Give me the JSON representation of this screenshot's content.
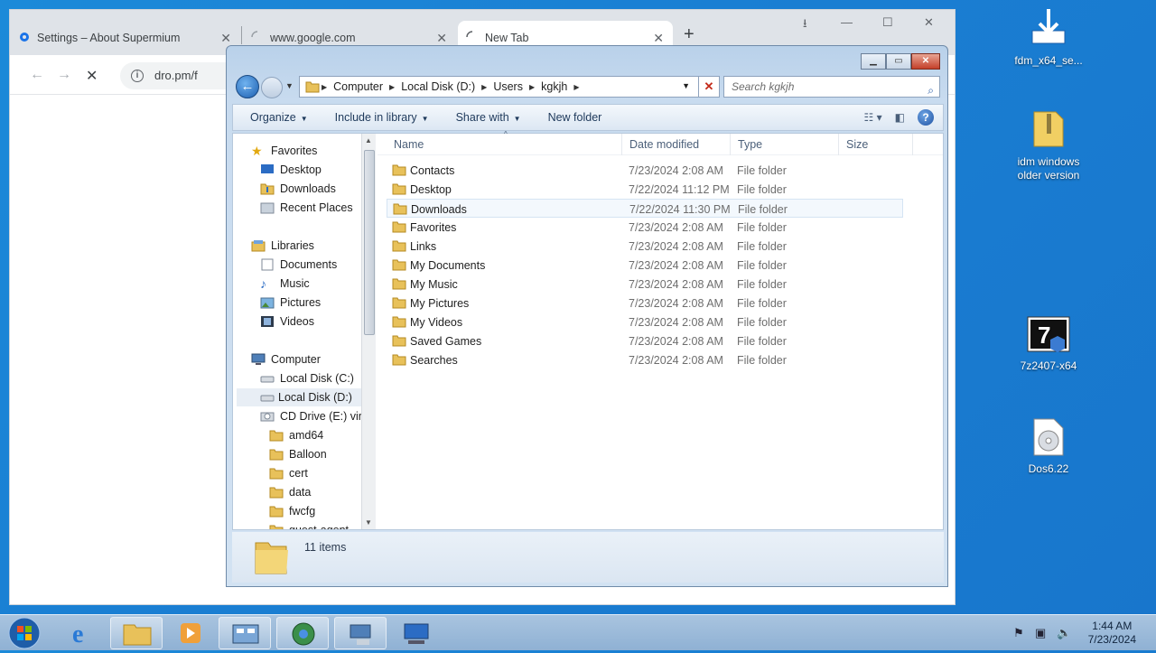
{
  "browser": {
    "tabs": [
      {
        "label": "Settings – About Supermium",
        "icon": "gear-icon"
      },
      {
        "label": "www.google.com",
        "icon": "loading-icon"
      },
      {
        "label": "New Tab",
        "icon": "loading-icon"
      }
    ],
    "address": "dro.pm/f"
  },
  "explorer": {
    "breadcrumb": [
      "Computer",
      "Local Disk (D:)",
      "Users",
      "kgkjh"
    ],
    "search_placeholder": "Search kgkjh",
    "toolbar": {
      "organize": "Organize",
      "include": "Include in library",
      "share": "Share with",
      "newfolder": "New folder"
    },
    "nav": {
      "favorites": "Favorites",
      "fav_items": [
        "Desktop",
        "Downloads",
        "Recent Places"
      ],
      "libraries": "Libraries",
      "lib_items": [
        "Documents",
        "Music",
        "Pictures",
        "Videos"
      ],
      "computer": "Computer",
      "drives": [
        "Local Disk (C:)",
        "Local Disk (D:)",
        "CD Drive (E:) virti"
      ],
      "cd_folders": [
        "amd64",
        "Balloon",
        "cert",
        "data",
        "fwcfg",
        "guest-agent"
      ]
    },
    "columns": {
      "name": "Name",
      "date": "Date modified",
      "type": "Type",
      "size": "Size"
    },
    "files": [
      {
        "name": "Contacts",
        "date": "7/23/2024 2:08 AM",
        "type": "File folder"
      },
      {
        "name": "Desktop",
        "date": "7/22/2024 11:12 PM",
        "type": "File folder"
      },
      {
        "name": "Downloads",
        "date": "7/22/2024 11:30 PM",
        "type": "File folder"
      },
      {
        "name": "Favorites",
        "date": "7/23/2024 2:08 AM",
        "type": "File folder"
      },
      {
        "name": "Links",
        "date": "7/23/2024 2:08 AM",
        "type": "File folder"
      },
      {
        "name": "My Documents",
        "date": "7/23/2024 2:08 AM",
        "type": "File folder"
      },
      {
        "name": "My Music",
        "date": "7/23/2024 2:08 AM",
        "type": "File folder"
      },
      {
        "name": "My Pictures",
        "date": "7/23/2024 2:08 AM",
        "type": "File folder"
      },
      {
        "name": "My Videos",
        "date": "7/23/2024 2:08 AM",
        "type": "File folder"
      },
      {
        "name": "Saved Games",
        "date": "7/23/2024 2:08 AM",
        "type": "File folder"
      },
      {
        "name": "Searches",
        "date": "7/23/2024 2:08 AM",
        "type": "File folder"
      }
    ],
    "status": "11 items"
  },
  "desktop": {
    "icons": [
      {
        "label": "fdm_x64_se...",
        "icon": "installer-icon"
      },
      {
        "label": "idm windows older version",
        "icon": "zip-folder-icon"
      },
      {
        "label": "7z2407-x64",
        "icon": "7zip-icon"
      },
      {
        "label": "Dos6.22",
        "icon": "disc-image-icon"
      }
    ]
  },
  "taskbar": {
    "time": "1:44 AM",
    "date": "7/23/2024"
  },
  "colors": {
    "folder": "#e8c15a",
    "accent": "#1d5fb0",
    "desktop": "#1a7fd3"
  }
}
